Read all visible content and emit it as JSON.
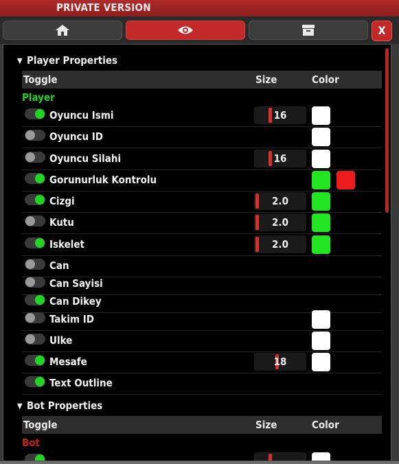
{
  "window": {
    "title": "PRIVATE VERSION",
    "close_label": "X"
  },
  "tabs": [
    {
      "icon": "home-icon",
      "active": false
    },
    {
      "icon": "eye-icon",
      "active": true
    },
    {
      "icon": "archive-icon",
      "active": false
    }
  ],
  "colors": {
    "accent": "#c42929",
    "on": "#22d522",
    "swatch_white": "#ffffff",
    "swatch_green": "#22e522",
    "swatch_red": "#ee1c1c",
    "player_group": "#1ed21e",
    "bot_group": "#c81e1e"
  },
  "player": {
    "header": "Player Properties",
    "columns": {
      "toggle": "Toggle",
      "size": "Size",
      "color": "Color"
    },
    "group_label": "Player",
    "rows": [
      {
        "label": "Oyuncu Ismi",
        "on": true,
        "size": "16",
        "size_fraction": 0.28,
        "colors": [
          "#ffffff"
        ]
      },
      {
        "label": "Oyuncu ID",
        "on": false,
        "size": null,
        "colors": [
          "#ffffff"
        ]
      },
      {
        "label": "Oyuncu Silahi",
        "on": false,
        "size": "16",
        "size_fraction": 0.28,
        "colors": [
          "#ffffff"
        ]
      },
      {
        "label": "Gorunurluk Kontrolu",
        "on": true,
        "size": null,
        "colors": [
          "#22e522",
          "#ee1c1c"
        ]
      },
      {
        "label": "Cizgi",
        "on": true,
        "size": "2.0",
        "size_fraction": 0.0,
        "colors": [
          "#22e522"
        ]
      },
      {
        "label": "Kutu",
        "on": false,
        "size": "2.0",
        "size_fraction": 0.0,
        "colors": [
          "#22e522"
        ]
      },
      {
        "label": "Iskelet",
        "on": true,
        "size": "2.0",
        "size_fraction": 0.0,
        "colors": [
          "#22e522"
        ]
      },
      {
        "label": "Can",
        "on": false,
        "size": null,
        "colors": []
      },
      {
        "label": "Can Sayisi",
        "on": false,
        "size": null,
        "colors": []
      },
      {
        "label": "Can Dikey",
        "on": true,
        "size": null,
        "colors": []
      },
      {
        "label": "Takim ID",
        "on": false,
        "size": null,
        "colors": [
          "#ffffff"
        ]
      },
      {
        "label": "Ulke",
        "on": false,
        "size": null,
        "colors": [
          "#ffffff"
        ]
      },
      {
        "label": "Mesafe",
        "on": true,
        "size": "18",
        "size_fraction": 0.42,
        "colors": [
          "#ffffff"
        ]
      },
      {
        "label": "Text Outline",
        "on": true,
        "size": null,
        "colors": []
      }
    ]
  },
  "bot": {
    "header": "Bot Properties",
    "columns": {
      "toggle": "Toggle",
      "size": "Size",
      "color": "Color"
    },
    "group_label": "Bot"
  }
}
